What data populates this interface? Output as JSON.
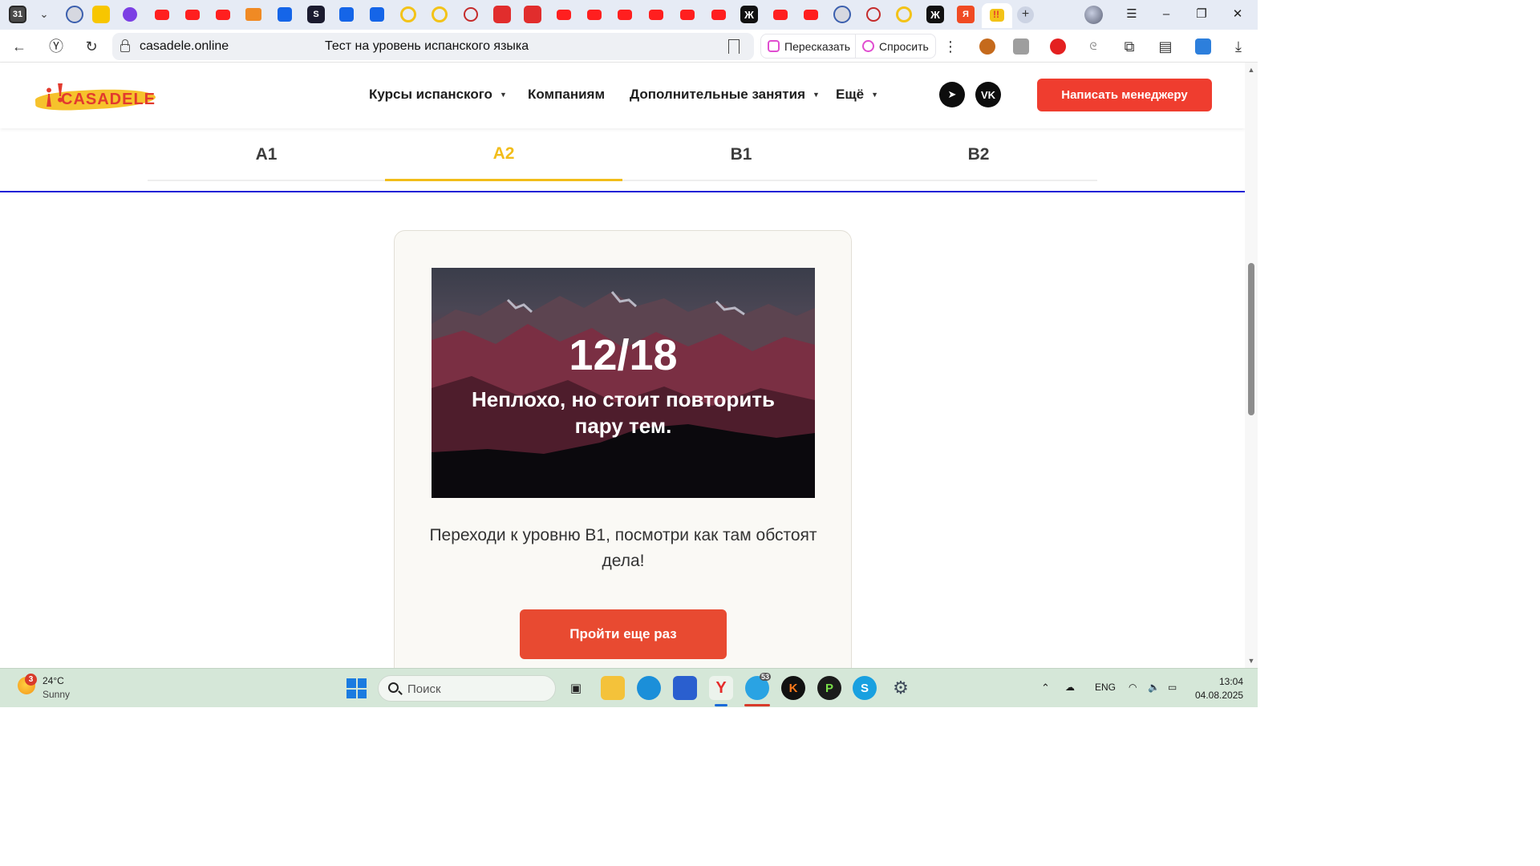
{
  "browser": {
    "first_tab_label": "31",
    "omnibox": {
      "url": "casadele.online",
      "page_title": "Тест на уровень испанского языка"
    },
    "assist": {
      "retell_label": "Пересказать",
      "ask_label": "Спросить"
    }
  },
  "site": {
    "logo_mark": "¡!",
    "logo_text": "CASADELE",
    "nav": [
      {
        "label": "Курсы испанского",
        "has_caret": true
      },
      {
        "label": "Компаниям",
        "has_caret": false
      },
      {
        "label": "Дополнительные занятия",
        "has_caret": true
      },
      {
        "label": "Ещё",
        "has_caret": true
      }
    ],
    "social": {
      "telegram": "➤",
      "vk": "VK"
    },
    "cta_label": "Написать менеджеру",
    "levels": [
      "A1",
      "A2",
      "B1",
      "B2"
    ],
    "active_level": "A2",
    "result": {
      "score": "12/18",
      "verdict": "Неплохо, но стоит повторить пару тем.",
      "advice": "Переходи к уровню B1, посмотри как там обстоят дела!",
      "retry_label": "Пройти еще раз"
    }
  },
  "taskbar": {
    "weather": {
      "badge": "3",
      "temp": "24°C",
      "desc": "Sunny"
    },
    "search_placeholder": "Поиск",
    "telegram_badge": "53",
    "language": "ENG",
    "time": "13:04",
    "date": "04.08.2025"
  },
  "colors": {
    "brand_red": "#ef3d2f",
    "active_tab_yellow": "#f2bd1a",
    "retry_button": "#e84a31",
    "card_background": "#faf9f5"
  }
}
